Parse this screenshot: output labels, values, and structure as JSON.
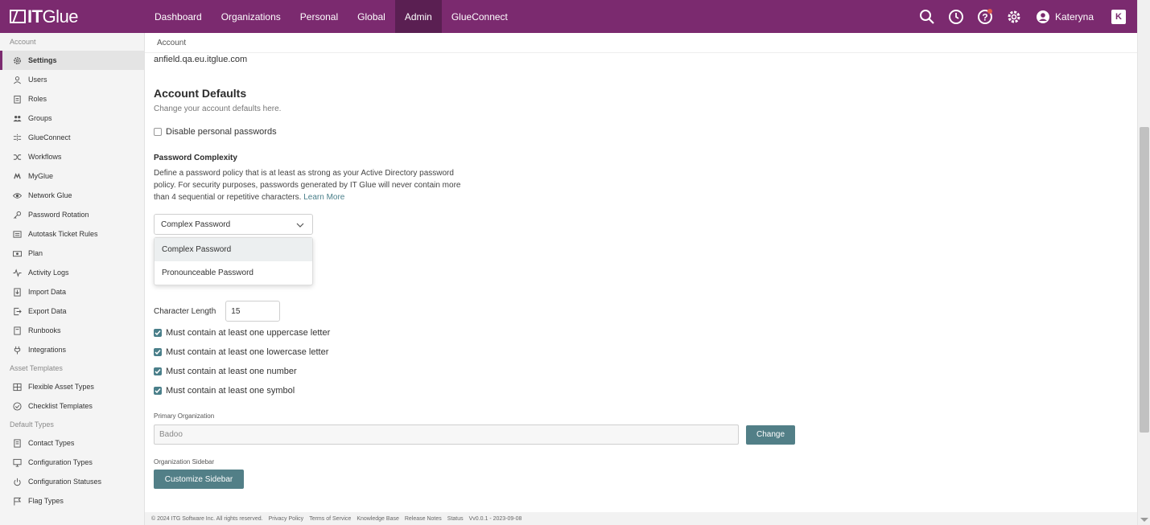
{
  "header": {
    "logo_it": "IT",
    "logo_glue": "Glue",
    "nav": [
      {
        "label": "Dashboard"
      },
      {
        "label": "Organizations"
      },
      {
        "label": "Personal"
      },
      {
        "label": "Global"
      },
      {
        "label": "Admin"
      },
      {
        "label": "GlueConnect"
      }
    ],
    "active_nav": "Admin",
    "user_name": "Kateryna",
    "badge": "K",
    "brand_color": "#7b2a6f"
  },
  "sidebar": {
    "sections": [
      {
        "title": "Account",
        "items": [
          {
            "label": "Settings",
            "icon": "gear-icon",
            "active": true
          },
          {
            "label": "Users",
            "icon": "user-icon"
          },
          {
            "label": "Roles",
            "icon": "clipboard-icon"
          },
          {
            "label": "Groups",
            "icon": "group-icon"
          },
          {
            "label": "GlueConnect",
            "icon": "connect-icon"
          },
          {
            "label": "Workflows",
            "icon": "shuffle-icon"
          },
          {
            "label": "MyGlue",
            "icon": "myglue-icon"
          },
          {
            "label": "Network Glue",
            "icon": "eye-icon"
          },
          {
            "label": "Password Rotation",
            "icon": "key-icon"
          },
          {
            "label": "Autotask Ticket Rules",
            "icon": "list-icon"
          },
          {
            "label": "Plan",
            "icon": "money-icon"
          },
          {
            "label": "Activity Logs",
            "icon": "pulse-icon"
          },
          {
            "label": "Import Data",
            "icon": "import-icon"
          },
          {
            "label": "Export Data",
            "icon": "export-icon"
          },
          {
            "label": "Runbooks",
            "icon": "book-icon"
          },
          {
            "label": "Integrations",
            "icon": "plug-icon"
          }
        ]
      },
      {
        "title": "Asset Templates",
        "items": [
          {
            "label": "Flexible Asset Types",
            "icon": "grid-icon"
          },
          {
            "label": "Checklist Templates",
            "icon": "check-circle-icon"
          }
        ]
      },
      {
        "title": "Default Types",
        "items": [
          {
            "label": "Contact Types",
            "icon": "contact-icon"
          },
          {
            "label": "Configuration Types",
            "icon": "monitor-icon"
          },
          {
            "label": "Configuration Statuses",
            "icon": "power-icon"
          },
          {
            "label": "Flag Types",
            "icon": "flag-icon"
          }
        ]
      }
    ]
  },
  "breadcrumb": "Account",
  "account_url": "anfield.qa.eu.itglue.com",
  "defaults": {
    "title": "Account Defaults",
    "subtitle": "Change your account defaults here.",
    "disable_personal_label": "Disable personal passwords",
    "disable_personal_checked": false
  },
  "password": {
    "title": "Password Complexity",
    "description": "Define a password policy that is at least as strong as your Active Directory password policy. For security purposes, passwords generated by IT Glue will never contain more than 4 sequential or repetitive characters.",
    "learn_more": "Learn More",
    "selected": "Complex Password",
    "options": [
      "Complex Password",
      "Pronounceable Password"
    ],
    "length_label": "Character Length",
    "length_value": "15",
    "rules": [
      {
        "label": "Must contain at least one uppercase letter",
        "checked": true
      },
      {
        "label": "Must contain at least one lowercase letter",
        "checked": true
      },
      {
        "label": "Must contain at least one number",
        "checked": true
      },
      {
        "label": "Must contain at least one symbol",
        "checked": true
      }
    ]
  },
  "primary_org": {
    "label": "Primary Organization",
    "value": "Badoo",
    "button": "Change"
  },
  "org_sidebar": {
    "label": "Organization Sidebar",
    "button": "Customize Sidebar"
  },
  "footer": {
    "copyright": "© 2024 ITG Software Inc. All rights reserved.",
    "links": [
      "Privacy Policy",
      "Terms of Service",
      "Knowledge Base",
      "Release Notes",
      "Status"
    ],
    "version": "Vv0.0.1 - 2023-09-08"
  },
  "accent_color": "#527f87"
}
